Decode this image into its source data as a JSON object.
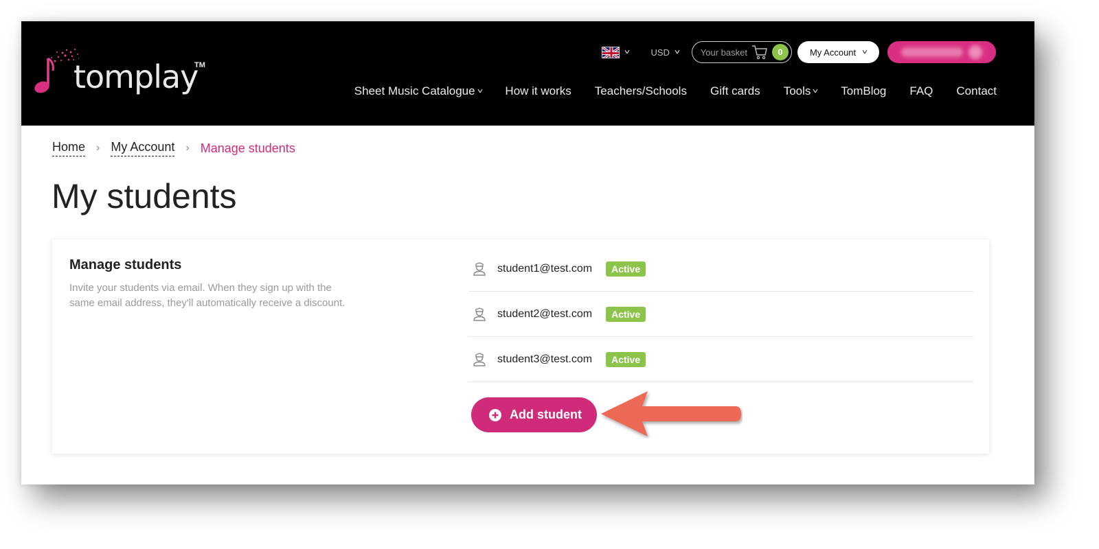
{
  "header": {
    "logo_text": "tomplay",
    "logo_tm": "TM",
    "currency": "USD",
    "basket_label": "Your basket",
    "basket_count": "0",
    "account_label": "My Account",
    "nav": [
      {
        "label": "Sheet Music Catalogue",
        "has_dropdown": true
      },
      {
        "label": "How it works",
        "has_dropdown": false
      },
      {
        "label": "Teachers/Schools",
        "has_dropdown": false
      },
      {
        "label": "Gift cards",
        "has_dropdown": false
      },
      {
        "label": "Tools",
        "has_dropdown": true
      },
      {
        "label": "TomBlog",
        "has_dropdown": false
      },
      {
        "label": "FAQ",
        "has_dropdown": false
      },
      {
        "label": "Contact",
        "has_dropdown": false
      }
    ]
  },
  "breadcrumb": {
    "home": "Home",
    "account": "My Account",
    "current": "Manage students"
  },
  "page_title": "My students",
  "card": {
    "title": "Manage students",
    "description": "Invite your students via email. When they sign up with the same email address, they'll automatically receive a discount.",
    "students": [
      {
        "email": "student1@test.com",
        "status": "Active"
      },
      {
        "email": "student2@test.com",
        "status": "Active"
      },
      {
        "email": "student3@test.com",
        "status": "Active"
      }
    ],
    "add_button": "Add student"
  },
  "colors": {
    "brand_pink": "#d02a7b",
    "active_green": "#8cc44b",
    "header_bg": "#000000",
    "annotation_arrow": "#ec6a55"
  }
}
